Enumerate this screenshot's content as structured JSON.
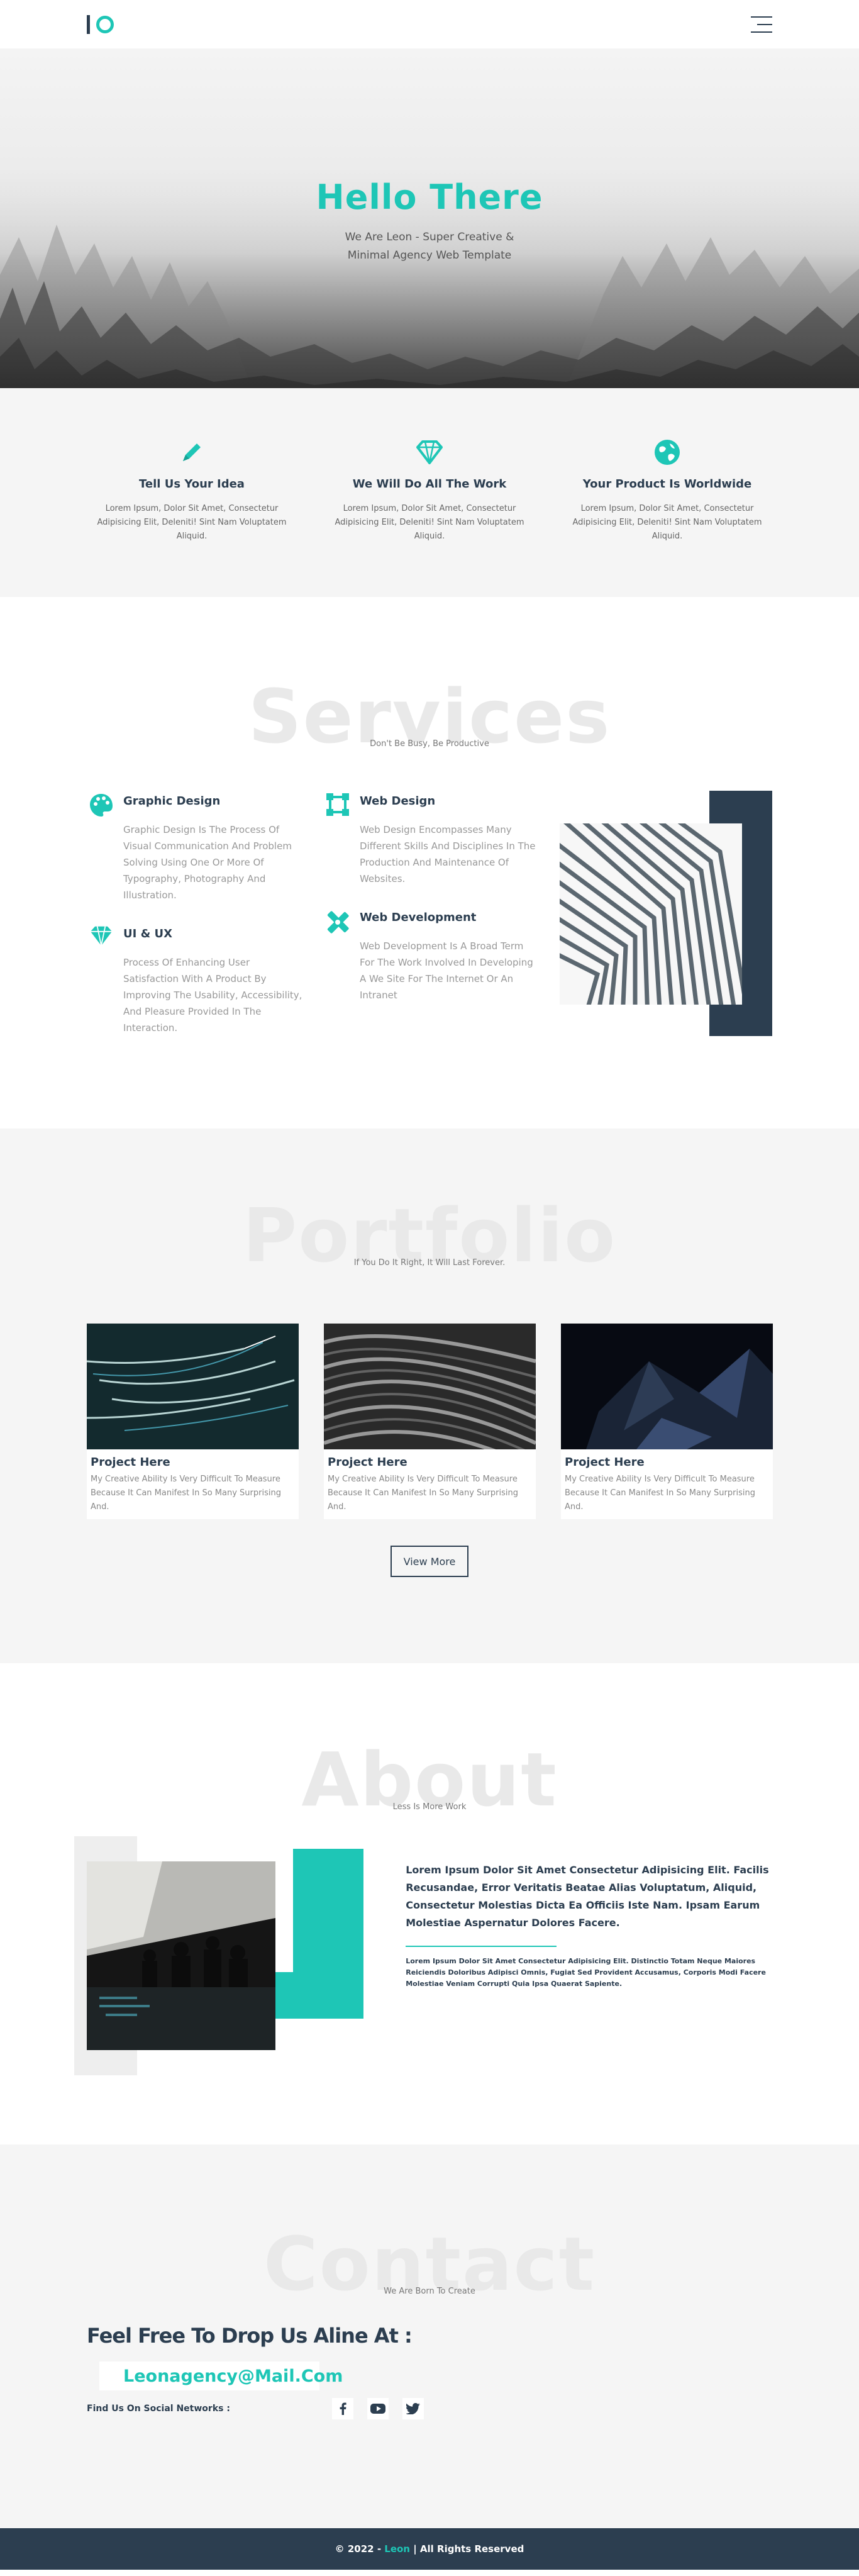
{
  "nav": {
    "logo_letter": "l",
    "logo_ring": "o",
    "menu_icon": "hamburger-icon"
  },
  "hero": {
    "title": "Hello There",
    "subtitle": "We Are Leon - Super Creative & Minimal Agency Web Template"
  },
  "features": [
    {
      "icon": "pen-icon",
      "title": "Tell Us Your Idea",
      "text": "Lorem Ipsum, Dolor Sit Amet, Consectetur Adipisicing Elit, Deleniti! Sint Nam Voluptatem Aliquid."
    },
    {
      "icon": "diamond-icon",
      "title": "We Will Do All The Work",
      "text": "Lorem Ipsum, Dolor Sit Amet, Consectetur Adipisicing Elit, Deleniti! Sint Nam Voluptatem Aliquid."
    },
    {
      "icon": "globe-icon",
      "title": "Your Product Is Worldwide",
      "text": "Lorem Ipsum, Dolor Sit Amet, Consectetur Adipisicing Elit, Deleniti! Sint Nam Voluptatem Aliquid."
    }
  ],
  "services": {
    "big_title": "Services",
    "subtitle": "Don't Be Busy, Be Productive",
    "items": [
      {
        "icon": "palette-icon",
        "title": "Graphic Design",
        "text": "Graphic Design Is The Process Of Visual Communication And Problem Solving Using One Or More Of Typography, Photography And Illustration."
      },
      {
        "icon": "diamond-icon",
        "title": "UI & UX",
        "text": "Process Of Enhancing User Satisfaction With A Product By Improving The Usability, Accessibility, And Pleasure Provided In The Interaction."
      },
      {
        "icon": "vector-square-icon",
        "title": "Web Design",
        "text": "Web Design Encompasses Many Different Skills And Disciplines In The Production And Maintenance Of Websites."
      },
      {
        "icon": "tools-icon",
        "title": "Web Development",
        "text": "Web Development Is A Broad Term For The Work Involved In Developing A We Site For The Internet Or An Intranet"
      }
    ]
  },
  "portfolio": {
    "big_title": "Portfolio",
    "subtitle": "If You Do It Right, It Will Last Forever.",
    "cards": [
      {
        "title": "Project Here",
        "text": "My Creative Ability Is Very Difficult To Measure Because It Can Manifest In So Many Surprising And."
      },
      {
        "title": "Project Here",
        "text": "My Creative Ability Is Very Difficult To Measure Because It Can Manifest In So Many Surprising And."
      },
      {
        "title": "Project Here",
        "text": "My Creative Ability Is Very Difficult To Measure Because It Can Manifest In So Many Surprising And."
      }
    ],
    "view_more": "View More"
  },
  "about": {
    "big_title": "About",
    "subtitle": "Less Is More Work",
    "lead": "Lorem Ipsum Dolor Sit Amet Consectetur Adipisicing Elit. Facilis Recusandae, Error Veritatis Beatae Alias Voluptatum, Aliquid, Consectetur Molestias Dicta Ea Officiis Iste Nam. Ipsam Earum Molestiae Aspernatur Dolores Facere.",
    "small": "Lorem Ipsum Dolor Sit Amet Consectetur Adipisicing Elit. Distinctio Totam Neque Maiores Reiciendis Doloribus Adipisci Omnis, Fugiat Sed Provident Accusamus, Corporis Modi Facere Molestiae Veniam Corrupti Quia Ipsa Quaerat Sapiente."
  },
  "contact": {
    "big_title": "Contact",
    "subtitle": "We Are Born To Create",
    "heading": "Feel Free To Drop Us Aline At :",
    "email": "Leonagency@Mail.Com",
    "social_label": "Find Us On Social Networks :",
    "social": [
      "facebook-icon",
      "youtube-icon",
      "twitter-icon"
    ]
  },
  "footer": {
    "prefix": "© 2022 - ",
    "brand": "Leon",
    "suffix": " | All Rights Reserved"
  },
  "colors": {
    "accent": "#1ec6b6",
    "dark": "#2c3e50",
    "light_bg": "#f5f5f5"
  }
}
